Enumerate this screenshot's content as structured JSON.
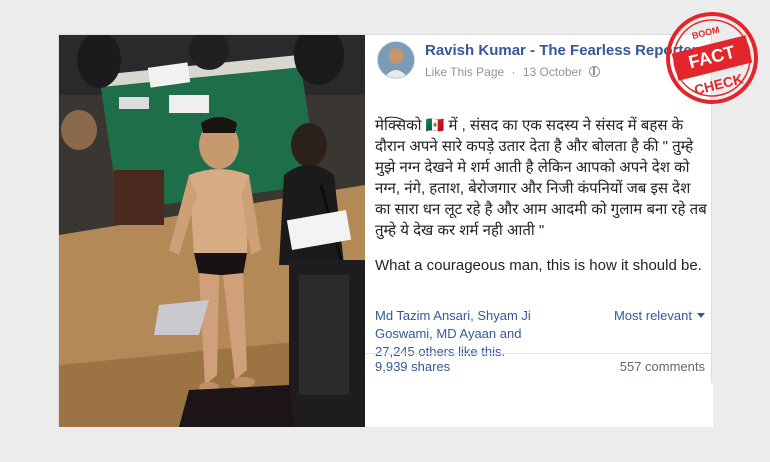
{
  "post": {
    "page_name": "Ravish Kumar - The Fearless Reporter",
    "page_type": "Like This Page",
    "date": "13 October",
    "hindi_text": "मेक्सिको 🇲🇽 में , संसद का एक सदस्य ने संसद में बहस के दौरान अपने सारे कपड़े उतार देता है और बोलता है की \" तुम्हे मुझे नग्न देखने मे शर्म आती है लेकिन आपको अपने देश को नग्न, नंगे, हताश, बेरोजगार और निजी कंपनियों जब इस देश का सारा धन लूट रहे है और आम आदमी को गुलाम बना रहे तब तुम्हे ये देख कर शर्म नही आती \"",
    "english_text": "What a courageous man, this is how it should be.",
    "reactions_text": "Md Tazim Ansari, Shyam Ji Goswami, MD Ayaan and 27,245 others like this.",
    "sort_label": "Most relevant",
    "shares": "9,939 shares",
    "comments": "557 comments"
  },
  "stamp": {
    "top": "BOOM",
    "line1": "FACT",
    "line2": "CHECK",
    "color": "#e3262c"
  },
  "colors": {
    "link": "#365899",
    "meta": "#90949c",
    "text": "#1d2129"
  },
  "icons": [
    "globe-icon",
    "dropdown-caret-icon"
  ]
}
